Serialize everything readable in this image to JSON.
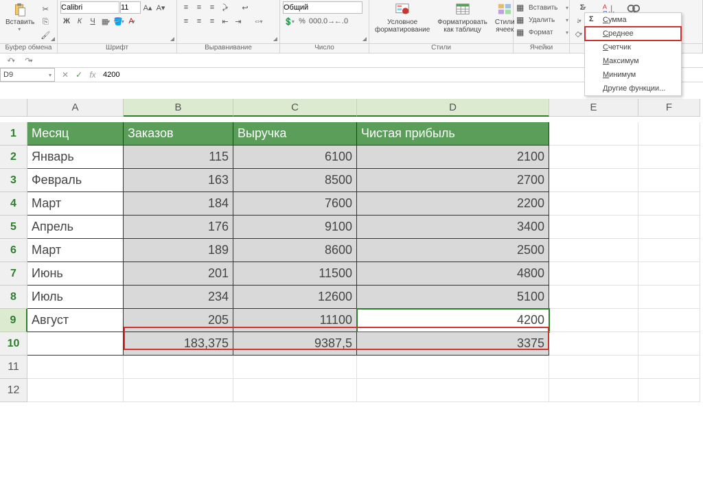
{
  "ribbon": {
    "clipboard": {
      "paste": "Вставить",
      "label": "Буфер обмена"
    },
    "font": {
      "name": "Calibri",
      "size": "11",
      "label": "Шрифт"
    },
    "alignment": {
      "label": "Выравнивание"
    },
    "number": {
      "format": "Общий",
      "label": "Число"
    },
    "styles": {
      "cond_format": "Условное\nформатирование",
      "as_table": "Форматировать\nкак таблицу",
      "cell_styles": "Стили\nячеек",
      "label": "Стили"
    },
    "cells": {
      "insert": "Вставить",
      "delete": "Удалить",
      "format": "Формат",
      "label": "Ячейки"
    }
  },
  "autosum_menu": {
    "items": [
      {
        "label": "Сумма",
        "accel": "С",
        "sigma": true
      },
      {
        "label": "Среднее",
        "accel": "С",
        "highlighted": true
      },
      {
        "label": "Счетчик",
        "accel": "С"
      },
      {
        "label": "Максимум",
        "accel": "М"
      },
      {
        "label": "Минимум",
        "accel": "М"
      },
      {
        "label": "Другие функции...",
        "accel": "Д"
      }
    ]
  },
  "name_box": "D9",
  "formula_value": "4200",
  "columns": [
    "A",
    "B",
    "C",
    "D",
    "E",
    "F"
  ],
  "headers": {
    "a": "Месяц",
    "b": "Заказов",
    "c": "Выручка",
    "d": "Чистая прибыль"
  },
  "rows": [
    {
      "month": "Январь",
      "orders": "115",
      "revenue": "6100",
      "profit": "2100"
    },
    {
      "month": "Февраль",
      "orders": "163",
      "revenue": "8500",
      "profit": "2700"
    },
    {
      "month": "Март",
      "orders": "184",
      "revenue": "7600",
      "profit": "2200"
    },
    {
      "month": "Апрель",
      "orders": "176",
      "revenue": "9100",
      "profit": "3400"
    },
    {
      "month": "Март",
      "orders": "189",
      "revenue": "8600",
      "profit": "2500"
    },
    {
      "month": "Июнь",
      "orders": "201",
      "revenue": "11500",
      "profit": "4800"
    },
    {
      "month": "Июль",
      "orders": "234",
      "revenue": "12600",
      "profit": "5100"
    },
    {
      "month": "Август",
      "orders": "205",
      "revenue": "11100",
      "profit": "4200"
    }
  ],
  "summary": {
    "orders": "183,375",
    "revenue": "9387,5",
    "profit": "3375"
  }
}
